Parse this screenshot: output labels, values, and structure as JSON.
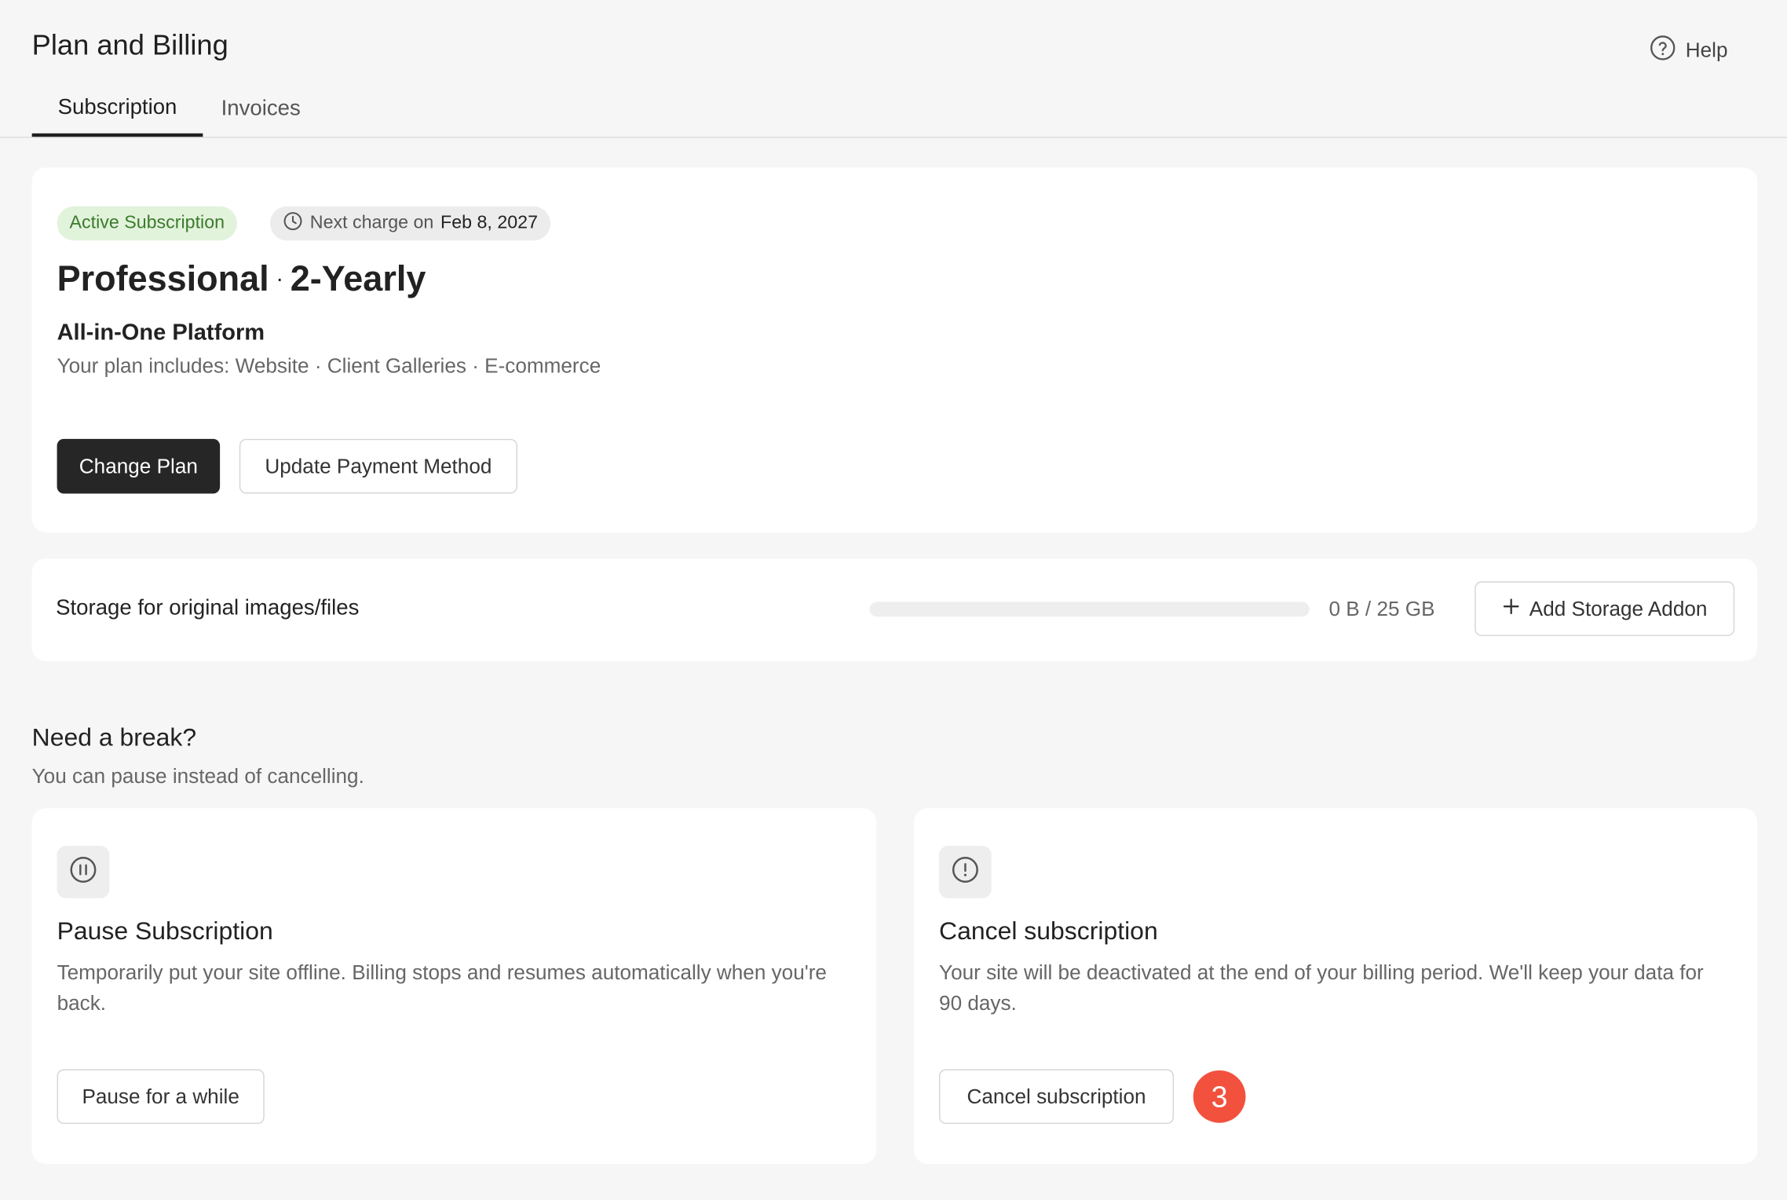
{
  "page": {
    "title": "Plan and Billing",
    "help_label": "Help"
  },
  "tabs": [
    {
      "label": "Subscription"
    },
    {
      "label": "Invoices"
    }
  ],
  "subscription": {
    "status": "Active Subscription",
    "next_charge_label": "Next charge on",
    "next_charge_date": "Feb 8, 2027",
    "plan_name": "Professional",
    "separator": "·",
    "plan_period": "2-Yearly",
    "platform_title": "All-in-One Platform",
    "includes": "Your plan includes: Website · Client Galleries · E-commerce",
    "change_plan_label": "Change Plan",
    "update_payment_label": "Update Payment Method"
  },
  "storage": {
    "label": "Storage for original images/files",
    "usage_text": "0 B / 25 GB",
    "used_fraction": 0,
    "add_addon_label": "Add Storage Addon"
  },
  "break_section": {
    "title": "Need a break?",
    "subtitle": "You can pause instead of cancelling."
  },
  "pause_card": {
    "title": "Pause Subscription",
    "description": "Temporarily put your site offline. Billing stops and resumes automatically when you're back.",
    "button_label": "Pause for a while"
  },
  "cancel_card": {
    "title": "Cancel subscription",
    "description": "Your site will be deactivated at the end of your billing period. We'll keep your data for 90 days.",
    "button_label": "Cancel subscription",
    "badge": "3"
  },
  "colors": {
    "active_bg": "#e2f3dc",
    "active_text": "#3c7a2c",
    "badge": "#f2513d",
    "primary_button": "#262626"
  }
}
